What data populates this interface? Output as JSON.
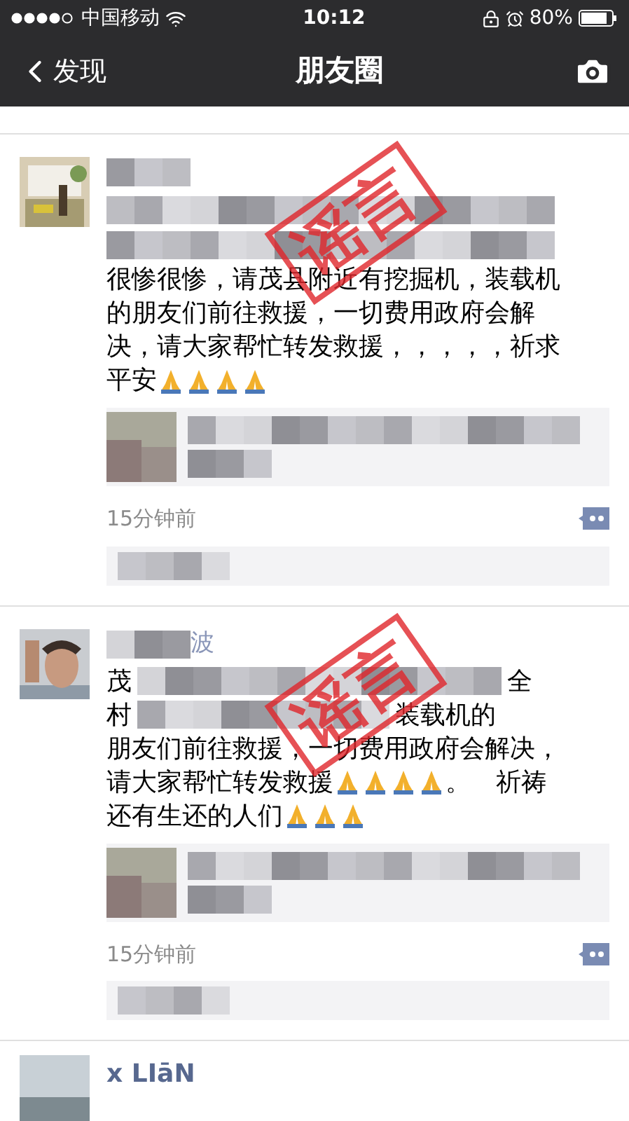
{
  "status_bar": {
    "carrier": "中国移动",
    "time": "10:12",
    "battery": "80%"
  },
  "nav": {
    "back": "发现",
    "title": "朋友圈"
  },
  "posts": [
    {
      "avatar": {
        "kind": "picture"
      },
      "stamp": "谣言",
      "lines": [
        {
          "kind": "blur"
        },
        {
          "kind": "blur"
        },
        {
          "kind": "rich",
          "segments": [
            {
              "kind": "text",
              "text": "很惨很惨，请茂县附近有挖掘机，装载机"
            }
          ]
        },
        {
          "kind": "rich",
          "segments": [
            {
              "kind": "text",
              "text": "的朋友们前往救援，一切费用政府会解"
            }
          ]
        },
        {
          "kind": "rich",
          "segments": [
            {
              "kind": "text",
              "text": "决，请大家帮忙转发救援，，，，，祈求"
            }
          ]
        },
        {
          "kind": "rich",
          "segments": [
            {
              "kind": "text",
              "text": "平安"
            },
            {
              "kind": "pray"
            },
            {
              "kind": "pray"
            },
            {
              "kind": "pray"
            },
            {
              "kind": "pray"
            }
          ]
        }
      ],
      "time": "15分钟前"
    },
    {
      "avatar": {
        "kind": "picture"
      },
      "name_tail": "波",
      "stamp": "谣言",
      "lines": [
        {
          "kind": "partial",
          "start": "茂",
          "end": "全"
        },
        {
          "kind": "partial",
          "start": "村",
          "end": "装载机的"
        },
        {
          "kind": "rich",
          "segments": [
            {
              "kind": "text",
              "text": "朋友们前往救援，一切费用政府会解决，"
            }
          ]
        },
        {
          "kind": "rich",
          "segments": [
            {
              "kind": "text",
              "text": "请大家帮忙转发救援"
            },
            {
              "kind": "pray"
            },
            {
              "kind": "pray"
            },
            {
              "kind": "pray"
            },
            {
              "kind": "pray"
            },
            {
              "kind": "text",
              "text": "。　祈祷"
            }
          ]
        },
        {
          "kind": "rich",
          "segments": [
            {
              "kind": "text",
              "text": "还有生还的人们"
            },
            {
              "kind": "pray"
            },
            {
              "kind": "pray"
            },
            {
              "kind": "pray"
            }
          ]
        }
      ],
      "time": "15分钟前"
    }
  ],
  "next_post": {
    "name": "x LIāN"
  }
}
